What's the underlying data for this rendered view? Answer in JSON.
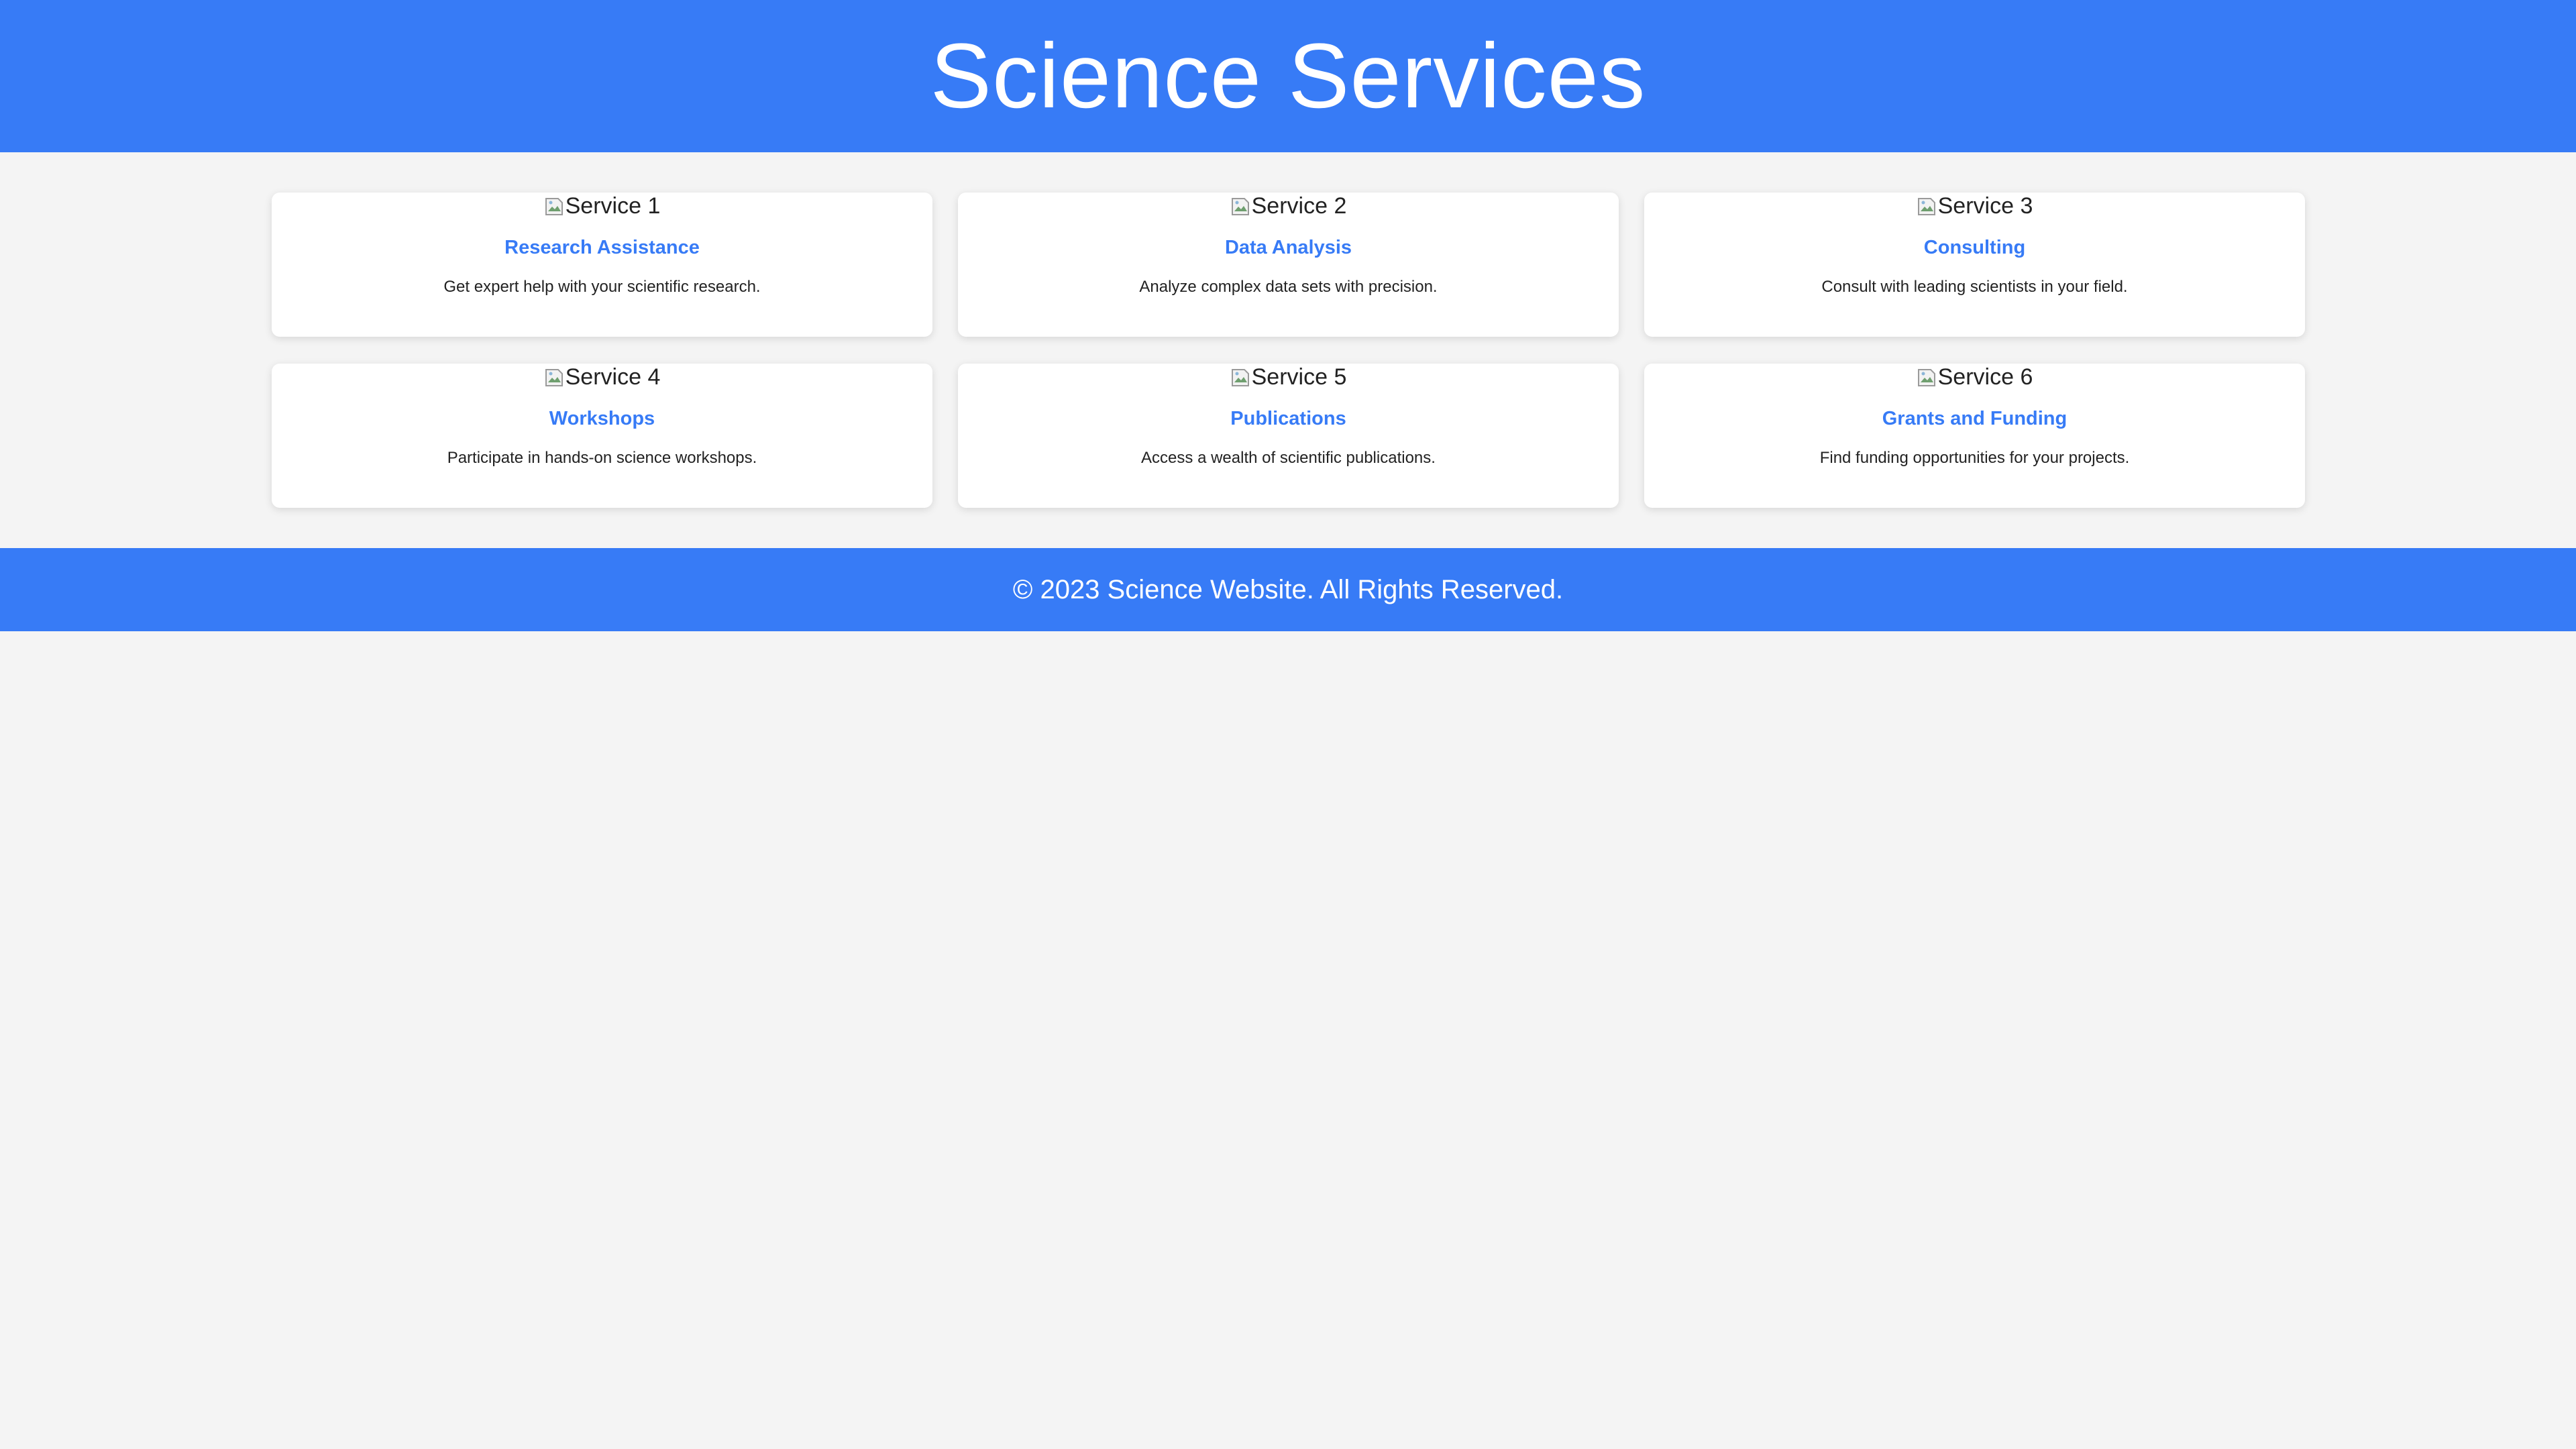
{
  "header": {
    "title": "Science Services"
  },
  "services": [
    {
      "image_alt": "Service 1",
      "title": "Research Assistance",
      "description": "Get expert help with your scientific research."
    },
    {
      "image_alt": "Service 2",
      "title": "Data Analysis",
      "description": "Analyze complex data sets with precision."
    },
    {
      "image_alt": "Service 3",
      "title": "Consulting",
      "description": "Consult with leading scientists in your field."
    },
    {
      "image_alt": "Service 4",
      "title": "Workshops",
      "description": "Participate in hands-on science workshops."
    },
    {
      "image_alt": "Service 5",
      "title": "Publications",
      "description": "Access a wealth of scientific publications."
    },
    {
      "image_alt": "Service 6",
      "title": "Grants and Funding",
      "description": "Find funding opportunities for your projects."
    }
  ],
  "footer": {
    "text": "© 2023 Science Website. All Rights Reserved."
  },
  "colors": {
    "accent": "#377bf6",
    "background": "#f4f4f4",
    "card": "#ffffff"
  }
}
